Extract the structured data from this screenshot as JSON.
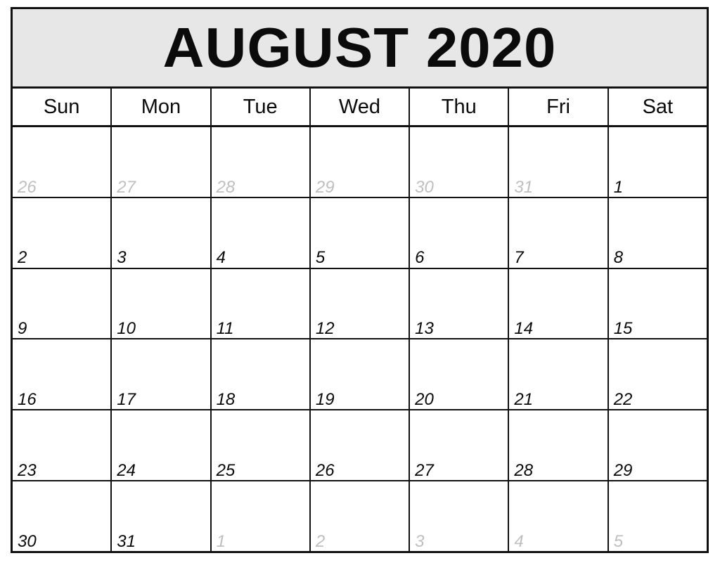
{
  "calendar": {
    "title": "AUGUST 2020",
    "month_name": "AUGUST",
    "year": "2020",
    "colors": {
      "title_bar_background": "#e7e7e7",
      "grid_line": "#111111",
      "cell_background": "#ffffff",
      "current_month_date": "#0b0b0b",
      "adjacent_month_date": "#bfbfbf",
      "page_background": "#ffffff"
    },
    "weekdays": [
      {
        "label": "Sun"
      },
      {
        "label": "Mon"
      },
      {
        "label": "Tue"
      },
      {
        "label": "Wed"
      },
      {
        "label": "Thu"
      },
      {
        "label": "Fri"
      },
      {
        "label": "Sat"
      }
    ],
    "weeks": [
      {
        "days": [
          {
            "number": "26",
            "in_month": false
          },
          {
            "number": "27",
            "in_month": false
          },
          {
            "number": "28",
            "in_month": false
          },
          {
            "number": "29",
            "in_month": false
          },
          {
            "number": "30",
            "in_month": false
          },
          {
            "number": "31",
            "in_month": false
          },
          {
            "number": "1",
            "in_month": true
          }
        ]
      },
      {
        "days": [
          {
            "number": "2",
            "in_month": true
          },
          {
            "number": "3",
            "in_month": true
          },
          {
            "number": "4",
            "in_month": true
          },
          {
            "number": "5",
            "in_month": true
          },
          {
            "number": "6",
            "in_month": true
          },
          {
            "number": "7",
            "in_month": true
          },
          {
            "number": "8",
            "in_month": true
          }
        ]
      },
      {
        "days": [
          {
            "number": "9",
            "in_month": true
          },
          {
            "number": "10",
            "in_month": true
          },
          {
            "number": "11",
            "in_month": true
          },
          {
            "number": "12",
            "in_month": true
          },
          {
            "number": "13",
            "in_month": true
          },
          {
            "number": "14",
            "in_month": true
          },
          {
            "number": "15",
            "in_month": true
          }
        ]
      },
      {
        "days": [
          {
            "number": "16",
            "in_month": true
          },
          {
            "number": "17",
            "in_month": true
          },
          {
            "number": "18",
            "in_month": true
          },
          {
            "number": "19",
            "in_month": true
          },
          {
            "number": "20",
            "in_month": true
          },
          {
            "number": "21",
            "in_month": true
          },
          {
            "number": "22",
            "in_month": true
          }
        ]
      },
      {
        "days": [
          {
            "number": "23",
            "in_month": true
          },
          {
            "number": "24",
            "in_month": true
          },
          {
            "number": "25",
            "in_month": true
          },
          {
            "number": "26",
            "in_month": true
          },
          {
            "number": "27",
            "in_month": true
          },
          {
            "number": "28",
            "in_month": true
          },
          {
            "number": "29",
            "in_month": true
          }
        ]
      },
      {
        "days": [
          {
            "number": "30",
            "in_month": true
          },
          {
            "number": "31",
            "in_month": true
          },
          {
            "number": "1",
            "in_month": false
          },
          {
            "number": "2",
            "in_month": false
          },
          {
            "number": "3",
            "in_month": false
          },
          {
            "number": "4",
            "in_month": false
          },
          {
            "number": "5",
            "in_month": false
          }
        ]
      }
    ]
  }
}
